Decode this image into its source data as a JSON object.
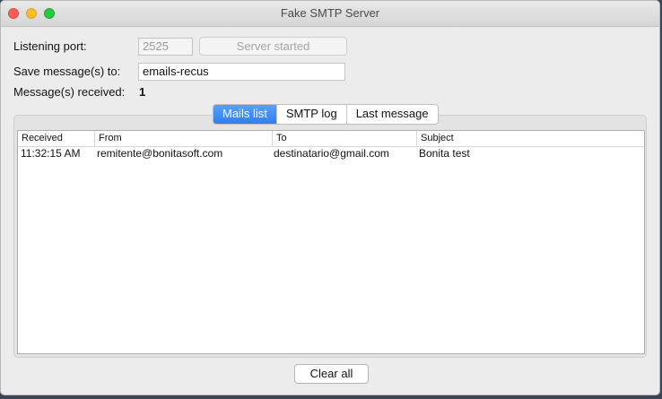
{
  "window": {
    "title": "Fake SMTP Server"
  },
  "form": {
    "port_label": "Listening port:",
    "port_value": "2525",
    "server_button": "Server started",
    "save_label": "Save message(s) to:",
    "save_value": "emails-recus",
    "received_label": "Message(s) received:",
    "received_count": "1"
  },
  "tabs": [
    {
      "label": "Mails list",
      "active": true
    },
    {
      "label": "SMTP log",
      "active": false
    },
    {
      "label": "Last message",
      "active": false
    }
  ],
  "table": {
    "columns": [
      "Received",
      "From",
      "To",
      "Subject"
    ],
    "rows": [
      [
        "11:32:15 AM",
        "remitente@bonitasoft.com",
        "destinatario@gmail.com",
        "Bonita test"
      ]
    ]
  },
  "actions": {
    "clear_all": "Clear all"
  },
  "colors": {
    "tab_active": "#2f7ff0"
  }
}
